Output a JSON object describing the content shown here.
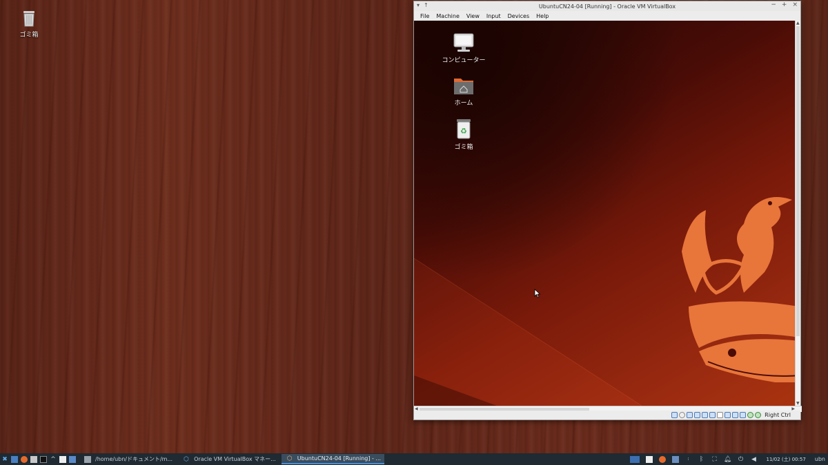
{
  "host_desktop": {
    "trash_label": "ゴミ箱"
  },
  "vbox_window": {
    "title": "UbuntuCN24-04 [Running] - Oracle VM VirtualBox",
    "menu": [
      "File",
      "Machine",
      "View",
      "Input",
      "Devices",
      "Help"
    ],
    "status_key": "Right Ctrl",
    "title_icons": [
      "window-menu-icon",
      "pin-icon"
    ],
    "window_controls": [
      "minimize-icon",
      "maximize-icon",
      "close-icon"
    ]
  },
  "guest_desktop": {
    "icons": [
      {
        "name": "computer-icon",
        "label": "コンピューター"
      },
      {
        "name": "home-folder-icon",
        "label": "ホーム"
      },
      {
        "name": "trash-icon",
        "label": "ゴミ箱"
      }
    ],
    "colors": {
      "wallpaper_dark": "#1e0503",
      "wallpaper_light": "#a8330f",
      "mascot": "#e8753a"
    }
  },
  "taskbar": {
    "tasks": [
      {
        "label": "/home/ubn/ドキュメント/m...",
        "active": false
      },
      {
        "label": "Oracle VM VirtualBox マネー...",
        "active": false
      },
      {
        "label": "UbuntuCN24-04 [Running] - ...",
        "active": true
      }
    ],
    "clock": "11/02 (土) 00:57",
    "user": "ubn"
  }
}
